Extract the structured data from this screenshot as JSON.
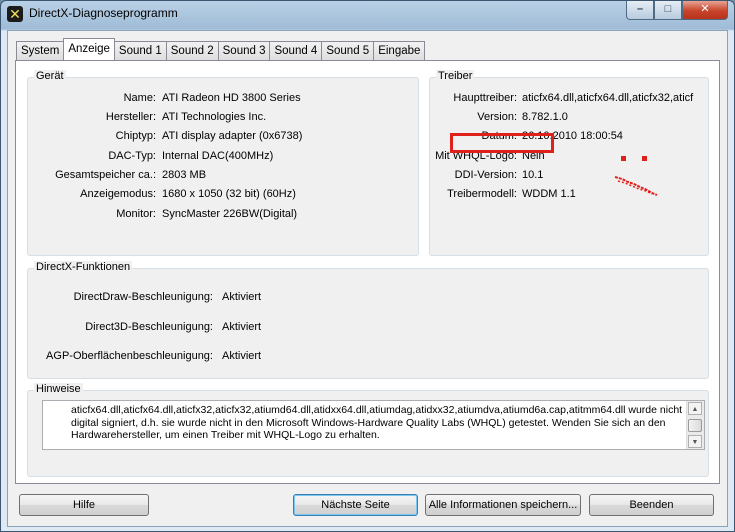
{
  "window": {
    "title": "DirectX-Diagnoseprogramm",
    "icon": "directx-x-icon",
    "controls": {
      "minimize": "–",
      "maximize": "□",
      "close": "✕"
    }
  },
  "tabs": [
    {
      "label": "System"
    },
    {
      "label": "Anzeige",
      "active": true
    },
    {
      "label": "Sound 1"
    },
    {
      "label": "Sound 2"
    },
    {
      "label": "Sound 3"
    },
    {
      "label": "Sound 4"
    },
    {
      "label": "Sound 5"
    },
    {
      "label": "Eingabe"
    }
  ],
  "device": {
    "title": "Gerät",
    "rows": [
      {
        "label": "Name:",
        "value": "ATI Radeon HD 3800 Series"
      },
      {
        "label": "Hersteller:",
        "value": "ATI Technologies Inc."
      },
      {
        "label": "Chiptyp:",
        "value": "ATI display adapter (0x6738)"
      },
      {
        "label": "DAC-Typ:",
        "value": "Internal DAC(400MHz)"
      },
      {
        "label": "Gesamtspeicher ca.:",
        "value": "2803 MB"
      },
      {
        "label": "Anzeigemodus:",
        "value": "1680 x 1050 (32 bit) (60Hz)"
      },
      {
        "label": "Monitor:",
        "value": "SyncMaster 226BW(Digital)"
      }
    ]
  },
  "driver": {
    "title": "Treiber",
    "rows": [
      {
        "label": "Haupttreiber:",
        "value": "aticfx64.dll,aticfx64.dll,aticfx32,aticf"
      },
      {
        "label": "Version:",
        "value": "8.782.1.0"
      },
      {
        "label": "Datum:",
        "value": "26.10.2010 18:00:54"
      },
      {
        "label": "Mit WHQL-Logo:",
        "value": "Nein"
      },
      {
        "label": "DDI-Version:",
        "value": "10.1"
      },
      {
        "label": "Treibermodell:",
        "value": "WDDM 1.1"
      }
    ],
    "highlight_color": "#e0201b"
  },
  "directx_features": {
    "title": "DirectX-Funktionen",
    "rows": [
      {
        "label": "DirectDraw-Beschleunigung:",
        "value": "Aktiviert"
      },
      {
        "label": "Direct3D-Beschleunigung:",
        "value": "Aktiviert"
      },
      {
        "label": "AGP-Oberflächenbeschleunigung:",
        "value": "Aktiviert"
      }
    ]
  },
  "notes": {
    "title": "Hinweise",
    "text": "aticfx64.dll,aticfx64.dll,aticfx32,aticfx32,atiumd64.dll,atidxx64.dll,atiumdag,atidxx32,atiumdva,atiumd6a.cap,atitmm64.dll wurde nicht digital signiert, d.h. sie wurde nicht in den Microsoft Windows-Hardware Quality Labs (WHQL) getestet. Wenden Sie sich an den Hardwarehersteller, um einen Treiber mit WHQL-Logo zu erhalten."
  },
  "buttons": {
    "help": "Hilfe",
    "next_page": "Nächste Seite",
    "save_all": "Alle Informationen speichern...",
    "exit": "Beenden"
  }
}
